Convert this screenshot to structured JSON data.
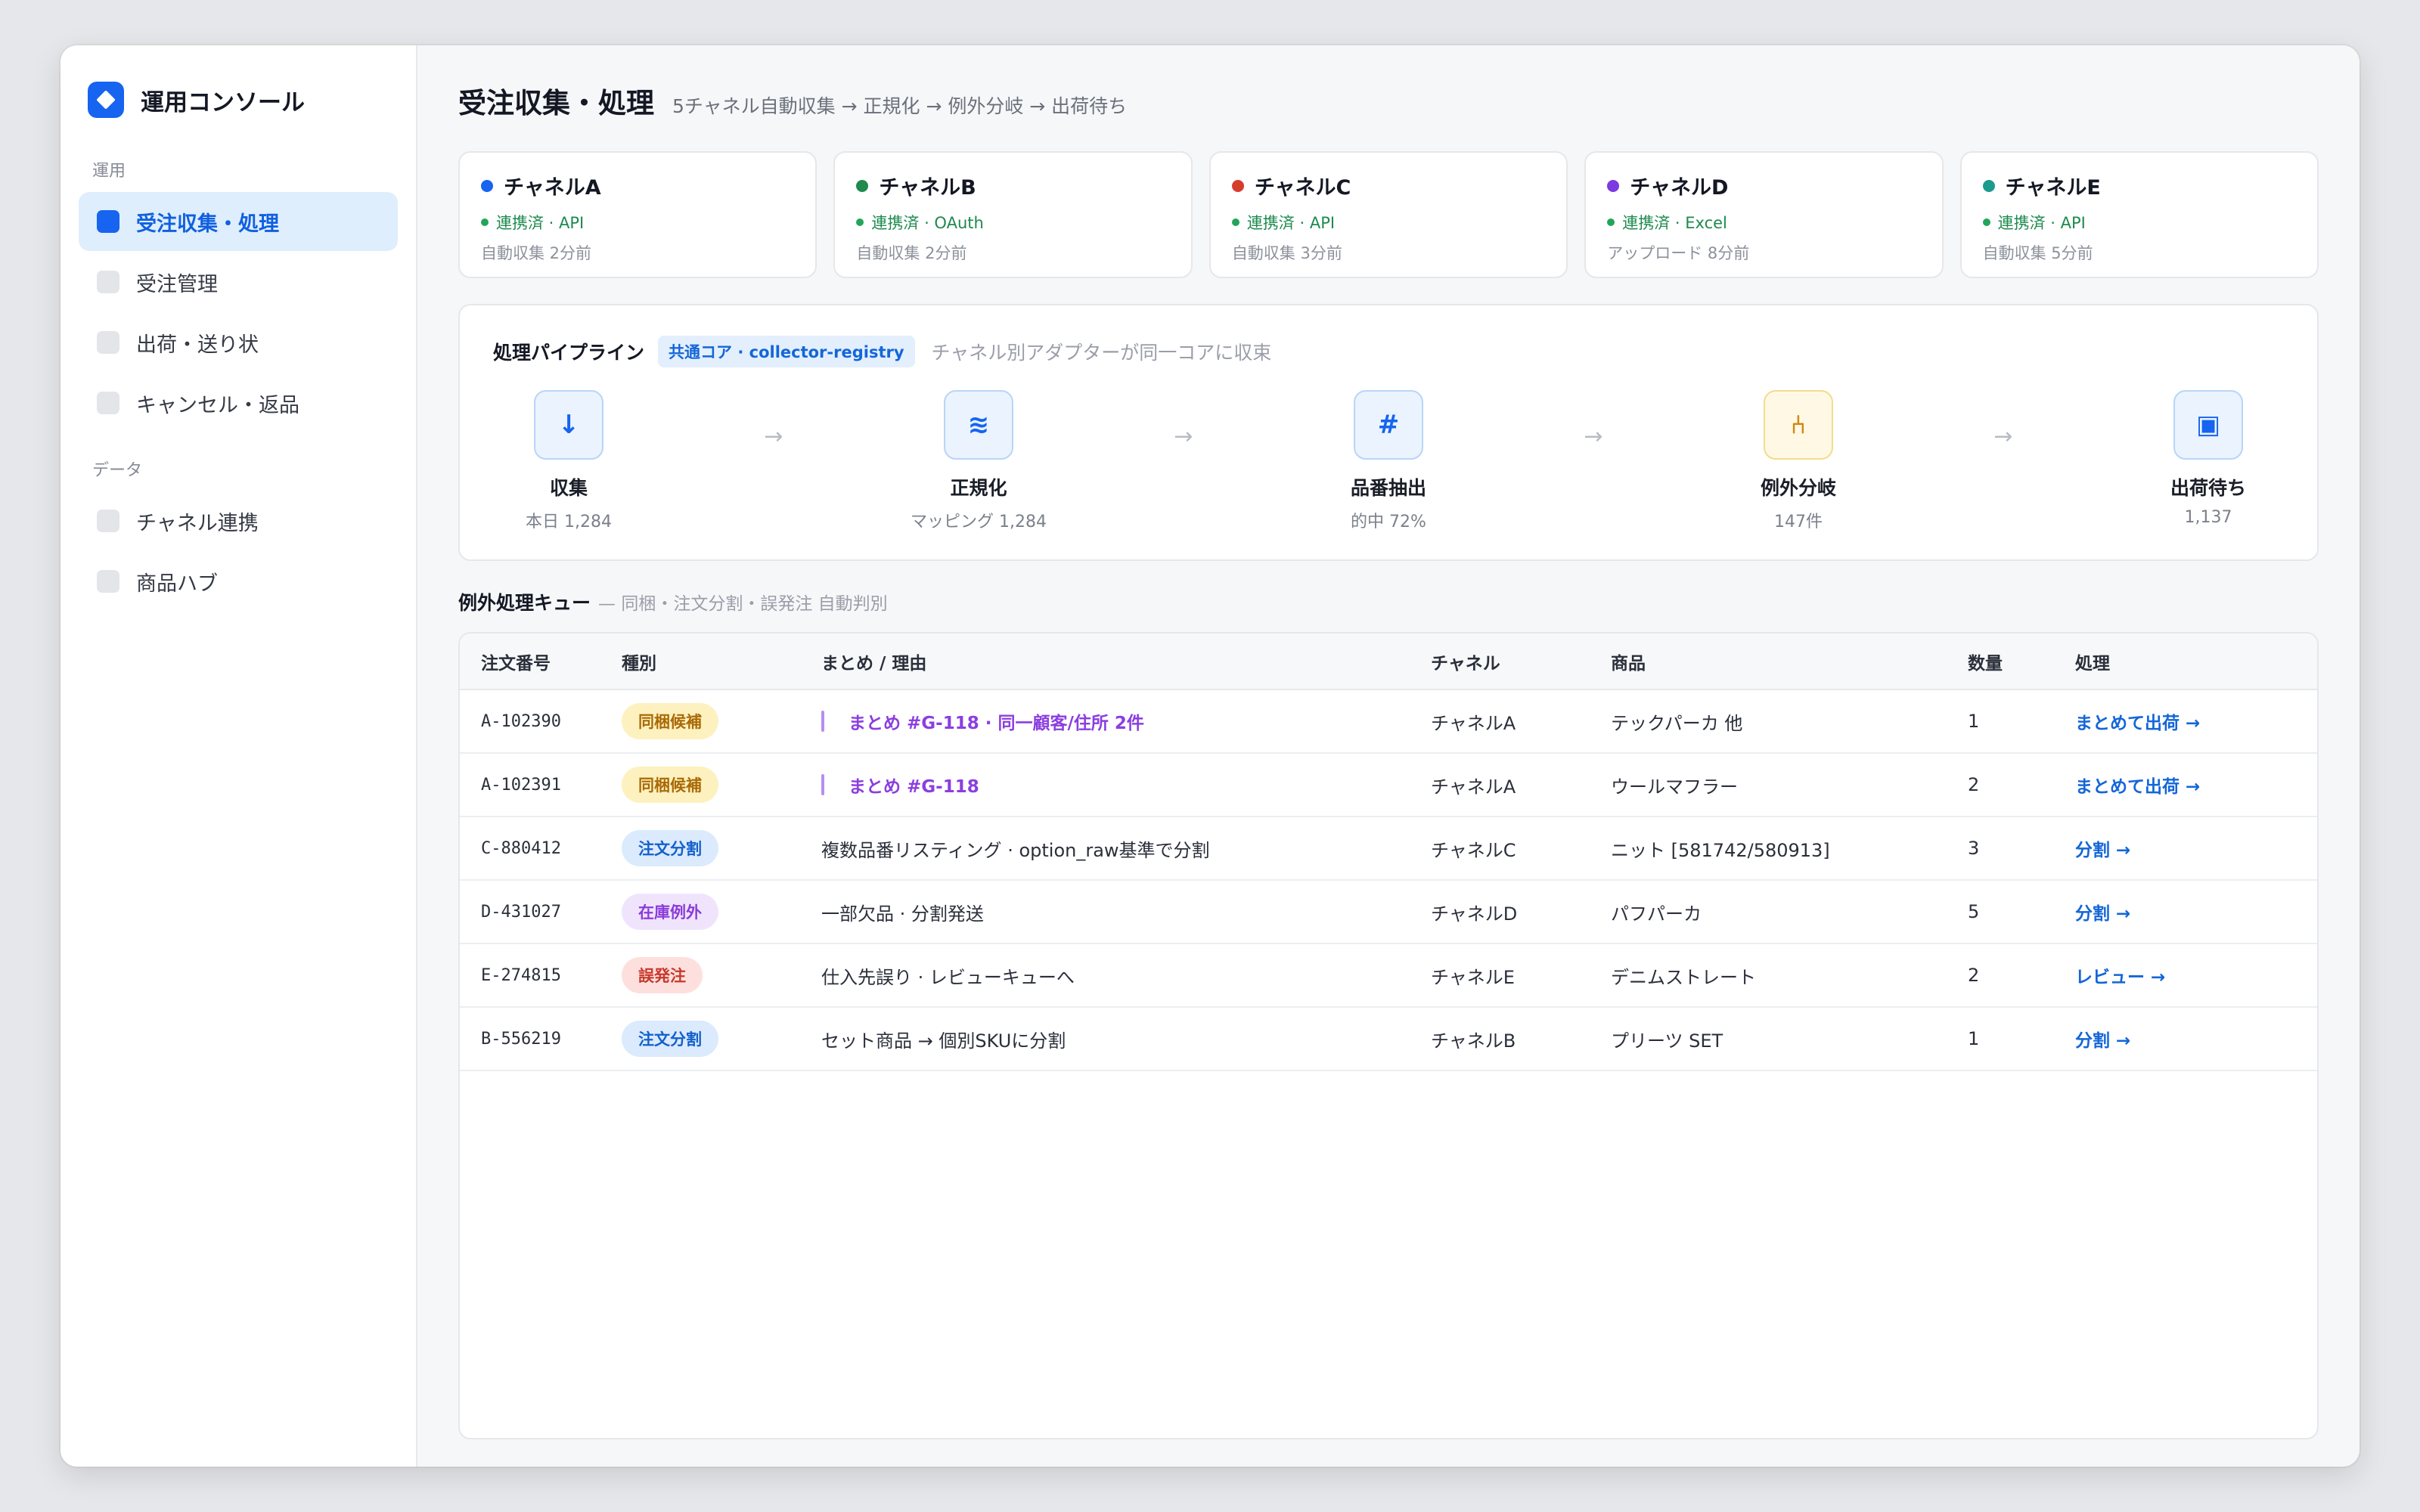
{
  "app": {
    "name": "運用コンソール"
  },
  "sidebar": {
    "section_ops": "運用",
    "section_data": "データ",
    "items": [
      {
        "label": "受注収集・処理",
        "active": true
      },
      {
        "label": "受注管理",
        "active": false
      },
      {
        "label": "出荷・送り状",
        "active": false
      },
      {
        "label": "キャンセル・返品",
        "active": false
      }
    ],
    "data_items": [
      {
        "label": "チャネル連携"
      },
      {
        "label": "商品ハブ"
      }
    ]
  },
  "header": {
    "title": "受注収集・処理",
    "subtitle": "5チャネル自動収集 → 正規化 → 例外分岐 → 出荷待ち"
  },
  "channels": [
    {
      "name": "チャネルA",
      "color": "#1664f0",
      "status": "連携済 · API",
      "time": "自動収集 2分前"
    },
    {
      "name": "チャネルB",
      "color": "#1e8a4c",
      "status": "連携済 · OAuth",
      "time": "自動収集 2分前"
    },
    {
      "name": "チャネルC",
      "color": "#d63c2c",
      "status": "連携済 · API",
      "time": "自動収集 3分前"
    },
    {
      "name": "チャネルD",
      "color": "#7c3ae0",
      "status": "連携済 · Excel",
      "time": "アップロード 8分前"
    },
    {
      "name": "チャネルE",
      "color": "#1c9a8e",
      "status": "連携済 · API",
      "time": "自動収集 5分前"
    }
  ],
  "pipeline": {
    "title": "処理パイプライン",
    "tag": "共通コア · collector-registry",
    "note": "チャネル別アダプターが同一コアに収束",
    "arrow": "→",
    "steps": [
      {
        "icon": "download-icon",
        "glyph": "↓",
        "name": "収集",
        "meta": "本日 1,284"
      },
      {
        "icon": "normalize-icon",
        "glyph": "≋",
        "name": "正規化",
        "meta": "マッピング 1,284"
      },
      {
        "icon": "hash-icon",
        "glyph": "#",
        "name": "品番抽出",
        "meta": "的中 72%"
      },
      {
        "icon": "branch-icon",
        "glyph": "⑃",
        "name": "例外分岐",
        "meta": "147件"
      },
      {
        "icon": "box-icon",
        "glyph": "▣",
        "name": "出荷待ち",
        "meta": "1,137"
      }
    ]
  },
  "queue": {
    "title": "例外処理キュー",
    "note": "— 同梱・注文分割・誤発注 自動判別",
    "columns": [
      "注文番号",
      "種別",
      "まとめ / 理由",
      "チャネル",
      "商品",
      "数量",
      "処理"
    ],
    "rows": [
      {
        "order": "A-102390",
        "type": "同梱候補",
        "type_style": "yellow",
        "reason": "まとめ #G-118 · 同一顧客/住所 2件",
        "is_group": true,
        "channel": "チャネルA",
        "product": "テックパーカ 他",
        "qty": "1",
        "action": "まとめて出荷 →"
      },
      {
        "order": "A-102391",
        "type": "同梱候補",
        "type_style": "yellow",
        "reason": "まとめ #G-118",
        "is_group": true,
        "channel": "チャネルA",
        "product": "ウールマフラー",
        "qty": "2",
        "action": "まとめて出荷 →"
      },
      {
        "order": "C-880412",
        "type": "注文分割",
        "type_style": "blue",
        "reason": "複数品番リスティング · option_raw基準で分割",
        "is_group": false,
        "channel": "チャネルC",
        "product": "ニット [581742/580913]",
        "qty": "3",
        "action": "分割 →"
      },
      {
        "order": "D-431027",
        "type": "在庫例外",
        "type_style": "purple",
        "reason": "一部欠品 · 分割発送",
        "is_group": false,
        "channel": "チャネルD",
        "product": "パフパーカ",
        "qty": "5",
        "action": "分割 →"
      },
      {
        "order": "E-274815",
        "type": "誤発注",
        "type_style": "red",
        "reason": "仕入先誤り · レビューキューへ",
        "is_group": false,
        "channel": "チャネルE",
        "product": "デニムストレート",
        "qty": "2",
        "action": "レビュー →"
      },
      {
        "order": "B-556219",
        "type": "注文分割",
        "type_style": "blue",
        "reason": "セット商品 → 個別SKUに分割",
        "is_group": false,
        "channel": "チャネルB",
        "product": "プリーツ SET",
        "qty": "1",
        "action": "分割 →"
      }
    ]
  }
}
